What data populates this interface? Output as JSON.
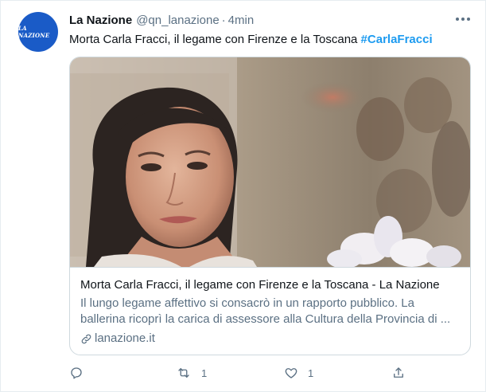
{
  "tweet": {
    "author_name": "La Nazione",
    "handle": "@qn_lanazione",
    "separator": "·",
    "time": "4min",
    "avatar_text": "LA NAZIONE",
    "text": "Morta Carla Fracci, il legame con Firenze e la Toscana ",
    "hashtag": "#CarlaFracci"
  },
  "card": {
    "title": "Morta Carla Fracci, il legame con Firenze e la Toscana - La Nazione",
    "description": "Il lungo legame affettivo si consacrò in un rapporto pubblico. La ballerina ricoprì la carica di assessore alla Cultura della Provincia di ...",
    "domain": "lanazione.it",
    "link_icon": "link-icon"
  },
  "actions": {
    "reply_icon": "reply-icon",
    "retweet_icon": "retweet-icon",
    "retweet_count": "1",
    "like_icon": "heart-icon",
    "like_count": "1",
    "share_icon": "share-icon"
  },
  "colors": {
    "hashtag": "#1d9bf0",
    "secondary_text": "#5b7083",
    "avatar_bg": "#1a5bc7"
  }
}
